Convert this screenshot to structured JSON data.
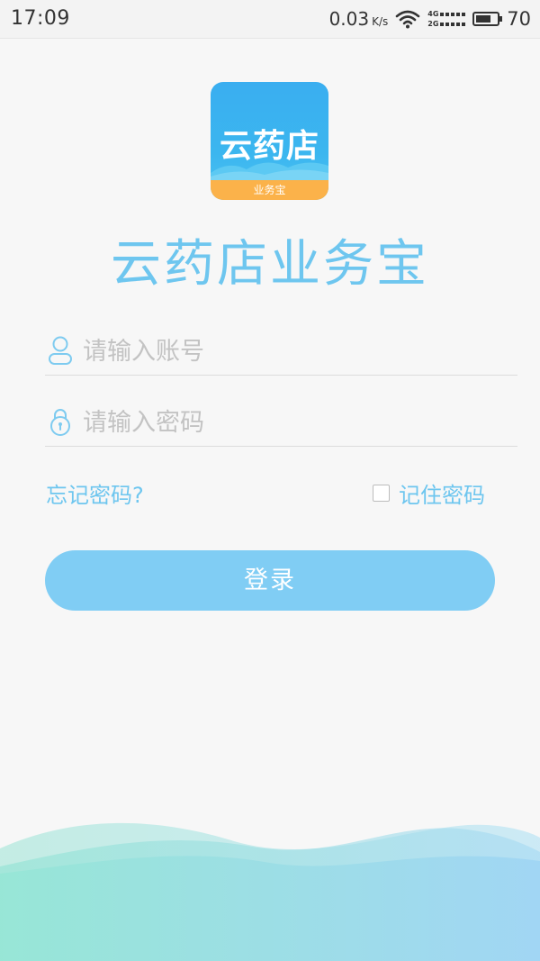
{
  "status_bar": {
    "time": "17:09",
    "net_speed": "0.03",
    "net_speed_unit": "K/s",
    "net_gen_top": "4G",
    "net_gen_bottom": "2G",
    "battery_level": "70",
    "battery_fraction": 0.7
  },
  "logo": {
    "name": "云药店",
    "band_label": "业务宝",
    "icon": "app-logo-icon"
  },
  "app_title": "云药店业务宝",
  "account_field": {
    "placeholder": "请输入账号",
    "value": "",
    "icon": "user-icon"
  },
  "password_field": {
    "placeholder": "请输入密码",
    "value": "",
    "icon": "lock-icon"
  },
  "forgot_password": "忘记密码?",
  "remember_password": {
    "label": "记住密码",
    "checked": false
  },
  "login_button": "登录",
  "colors": {
    "accent": "#6ec6ef",
    "button": "#80cdf4",
    "logo_blue": "#3aaef0",
    "logo_orange": "#fbb24a"
  }
}
